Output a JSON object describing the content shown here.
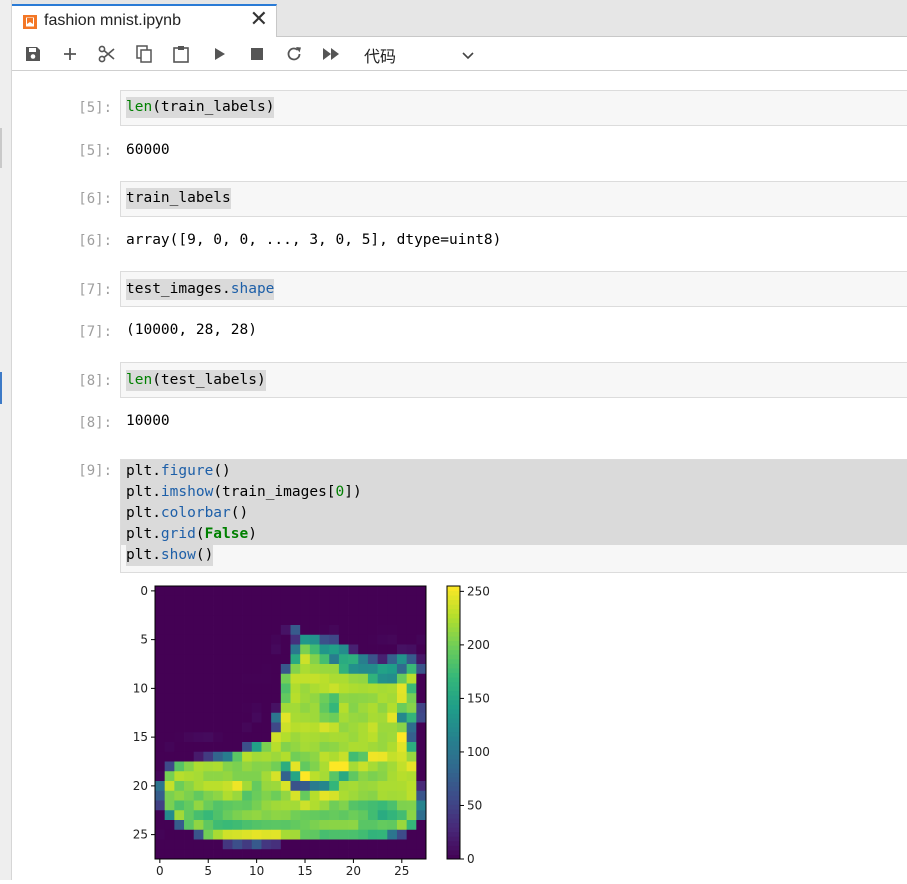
{
  "tab": {
    "title": "fashion mnist.ipynb",
    "close": "✕"
  },
  "toolbar": {
    "buttons": [
      "save-icon",
      "add-icon",
      "cut-icon",
      "copy-icon",
      "paste-icon",
      "run-icon",
      "stop-icon",
      "restart-icon",
      "run-all-icon"
    ],
    "cell_type": "代码"
  },
  "cells": [
    {
      "in_prompt": "[5]:",
      "code": "len(train_labels)",
      "out_prompt": "[5]:",
      "output": "60000"
    },
    {
      "in_prompt": "[6]:",
      "code": "train_labels",
      "out_prompt": "[6]:",
      "output": "array([9, 0, 0, ..., 3, 0, 5], dtype=uint8)"
    },
    {
      "in_prompt": "[7]:",
      "code": "test_images.shape",
      "out_prompt": "[7]:",
      "output": "(10000, 28, 28)"
    },
    {
      "in_prompt": "[8]:",
      "code": "len(test_labels)",
      "out_prompt": "[8]:",
      "output": "10000"
    },
    {
      "in_prompt": "[9]:",
      "code_lines": [
        "plt.figure()",
        "plt.imshow(train_images[0])",
        "plt.colorbar()",
        "plt.grid(False)",
        "plt.show()"
      ]
    }
  ],
  "tokens": {
    "len": "len",
    "train_labels_arg": "(train_labels)",
    "train_labels": "train_labels",
    "test_images": "test_images.",
    "shape": "shape",
    "test_labels_arg": "(test_labels)",
    "plt": "plt.",
    "figure": "figure",
    "imshow": "imshow",
    "imshow_arg_a": "(train_images[",
    "zero": "0",
    "imshow_arg_b": "])",
    "colorbar": "colorbar",
    "grid": "grid",
    "false": "False",
    "show": "show",
    "call": "()",
    "open": "(",
    "close": ")"
  },
  "chart_data": {
    "type": "heatmap",
    "colormap": "viridis",
    "xticks": [
      0,
      5,
      10,
      15,
      20,
      25
    ],
    "yticks": [
      0,
      5,
      10,
      15,
      20,
      25
    ],
    "xlim": [
      -0.5,
      27.5
    ],
    "ylim": [
      27.5,
      -0.5
    ],
    "colorbar_ticks": [
      0,
      50,
      100,
      150,
      200,
      250
    ],
    "colorbar_range": [
      0,
      255
    ],
    "grid": false,
    "rows": 28,
    "cols": 28,
    "values": [
      [
        0,
        0,
        0,
        0,
        0,
        0,
        0,
        0,
        0,
        0,
        0,
        0,
        0,
        0,
        0,
        0,
        0,
        0,
        0,
        0,
        0,
        0,
        0,
        0,
        0,
        0,
        0,
        0
      ],
      [
        0,
        0,
        0,
        0,
        0,
        0,
        0,
        0,
        0,
        0,
        0,
        0,
        0,
        0,
        0,
        0,
        0,
        0,
        0,
        0,
        0,
        0,
        0,
        0,
        0,
        0,
        0,
        0
      ],
      [
        0,
        0,
        0,
        0,
        0,
        0,
        0,
        0,
        0,
        0,
        0,
        0,
        0,
        0,
        0,
        0,
        0,
        0,
        0,
        0,
        0,
        0,
        0,
        0,
        0,
        0,
        0,
        0
      ],
      [
        0,
        0,
        0,
        0,
        0,
        0,
        0,
        0,
        0,
        0,
        0,
        0,
        0,
        0,
        0,
        0,
        0,
        0,
        0,
        0,
        0,
        0,
        0,
        0,
        0,
        0,
        0,
        0
      ],
      [
        0,
        0,
        0,
        0,
        0,
        0,
        0,
        0,
        0,
        0,
        0,
        0,
        0,
        13,
        73,
        0,
        0,
        1,
        4,
        0,
        0,
        0,
        0,
        1,
        1,
        0,
        0,
        0
      ],
      [
        0,
        0,
        0,
        0,
        0,
        0,
        0,
        0,
        0,
        0,
        0,
        0,
        3,
        0,
        36,
        136,
        127,
        62,
        54,
        0,
        0,
        0,
        1,
        3,
        4,
        0,
        0,
        3
      ],
      [
        0,
        0,
        0,
        0,
        0,
        0,
        0,
        0,
        0,
        0,
        0,
        0,
        6,
        0,
        102,
        204,
        176,
        134,
        144,
        123,
        23,
        0,
        0,
        0,
        0,
        12,
        10,
        0
      ],
      [
        0,
        0,
        0,
        0,
        0,
        0,
        0,
        0,
        0,
        0,
        0,
        0,
        0,
        0,
        155,
        236,
        207,
        178,
        107,
        156,
        161,
        109,
        64,
        23,
        77,
        130,
        72,
        15
      ],
      [
        0,
        0,
        0,
        0,
        0,
        0,
        0,
        0,
        0,
        0,
        0,
        1,
        0,
        69,
        207,
        223,
        218,
        216,
        216,
        163,
        127,
        121,
        122,
        146,
        141,
        88,
        172,
        66
      ],
      [
        0,
        0,
        0,
        0,
        0,
        0,
        0,
        0,
        0,
        1,
        1,
        1,
        0,
        200,
        232,
        232,
        233,
        229,
        223,
        223,
        215,
        213,
        164,
        127,
        123,
        196,
        229,
        0
      ],
      [
        0,
        0,
        0,
        0,
        0,
        0,
        0,
        0,
        0,
        0,
        0,
        0,
        0,
        183,
        225,
        216,
        223,
        228,
        235,
        227,
        224,
        222,
        224,
        221,
        223,
        245,
        173,
        0
      ],
      [
        0,
        0,
        0,
        0,
        0,
        0,
        0,
        0,
        0,
        0,
        0,
        0,
        0,
        193,
        228,
        218,
        213,
        198,
        180,
        212,
        210,
        211,
        213,
        223,
        220,
        243,
        202,
        0
      ],
      [
        0,
        0,
        0,
        0,
        0,
        0,
        0,
        0,
        0,
        1,
        3,
        0,
        12,
        219,
        220,
        212,
        218,
        192,
        169,
        227,
        208,
        218,
        224,
        212,
        226,
        197,
        209,
        52
      ],
      [
        0,
        0,
        0,
        0,
        0,
        0,
        0,
        0,
        0,
        0,
        6,
        0,
        99,
        244,
        222,
        220,
        218,
        203,
        198,
        221,
        215,
        213,
        222,
        220,
        245,
        119,
        167,
        56
      ],
      [
        0,
        0,
        0,
        0,
        0,
        0,
        0,
        0,
        0,
        4,
        0,
        0,
        55,
        236,
        228,
        230,
        228,
        240,
        232,
        213,
        218,
        223,
        234,
        217,
        217,
        209,
        92,
        0
      ],
      [
        0,
        0,
        1,
        4,
        6,
        7,
        2,
        0,
        0,
        0,
        0,
        0,
        237,
        226,
        217,
        223,
        222,
        219,
        222,
        221,
        216,
        223,
        229,
        215,
        218,
        255,
        77,
        0
      ],
      [
        0,
        3,
        0,
        0,
        0,
        0,
        0,
        0,
        0,
        62,
        145,
        204,
        228,
        207,
        213,
        221,
        218,
        208,
        211,
        218,
        224,
        223,
        219,
        215,
        224,
        244,
        159,
        0
      ],
      [
        0,
        0,
        0,
        0,
        18,
        44,
        82,
        107,
        189,
        228,
        220,
        222,
        217,
        226,
        200,
        205,
        211,
        230,
        224,
        234,
        176,
        188,
        250,
        248,
        233,
        238,
        215,
        0
      ],
      [
        0,
        57,
        187,
        208,
        224,
        221,
        224,
        208,
        204,
        214,
        208,
        209,
        200,
        159,
        245,
        193,
        206,
        223,
        255,
        255,
        221,
        234,
        221,
        211,
        220,
        232,
        246,
        0
      ],
      [
        3,
        202,
        228,
        224,
        221,
        211,
        211,
        214,
        205,
        205,
        205,
        220,
        240,
        80,
        150,
        255,
        229,
        221,
        188,
        154,
        191,
        210,
        204,
        209,
        222,
        228,
        225,
        0
      ],
      [
        98,
        233,
        198,
        210,
        222,
        229,
        229,
        234,
        249,
        220,
        194,
        215,
        217,
        241,
        65,
        73,
        106,
        117,
        168,
        219,
        221,
        215,
        217,
        223,
        223,
        224,
        229,
        29
      ],
      [
        75,
        204,
        212,
        204,
        193,
        205,
        211,
        225,
        216,
        185,
        197,
        206,
        198,
        213,
        240,
        195,
        227,
        245,
        239,
        223,
        218,
        212,
        209,
        222,
        220,
        221,
        230,
        67
      ],
      [
        48,
        203,
        183,
        194,
        213,
        197,
        185,
        190,
        194,
        192,
        202,
        214,
        219,
        221,
        220,
        236,
        225,
        216,
        199,
        206,
        186,
        181,
        177,
        172,
        181,
        205,
        206,
        115
      ],
      [
        0,
        122,
        219,
        193,
        179,
        171,
        183,
        196,
        204,
        210,
        213,
        207,
        211,
        210,
        200,
        196,
        194,
        191,
        195,
        191,
        198,
        192,
        176,
        156,
        167,
        177,
        210,
        92
      ],
      [
        0,
        0,
        74,
        189,
        212,
        191,
        175,
        172,
        175,
        181,
        185,
        188,
        189,
        188,
        193,
        198,
        204,
        209,
        210,
        210,
        211,
        188,
        188,
        194,
        192,
        216,
        170,
        0
      ],
      [
        2,
        0,
        0,
        0,
        66,
        200,
        222,
        237,
        239,
        242,
        246,
        243,
        244,
        221,
        220,
        193,
        191,
        179,
        182,
        182,
        181,
        176,
        166,
        168,
        99,
        58,
        0,
        0
      ],
      [
        0,
        0,
        0,
        0,
        0,
        0,
        0,
        40,
        61,
        44,
        72,
        41,
        35,
        0,
        0,
        0,
        0,
        0,
        0,
        0,
        0,
        0,
        0,
        0,
        0,
        0,
        0,
        0
      ],
      [
        0,
        0,
        0,
        0,
        0,
        0,
        0,
        0,
        0,
        0,
        0,
        0,
        0,
        0,
        0,
        0,
        0,
        0,
        0,
        0,
        0,
        0,
        0,
        0,
        0,
        0,
        0,
        0
      ]
    ]
  }
}
